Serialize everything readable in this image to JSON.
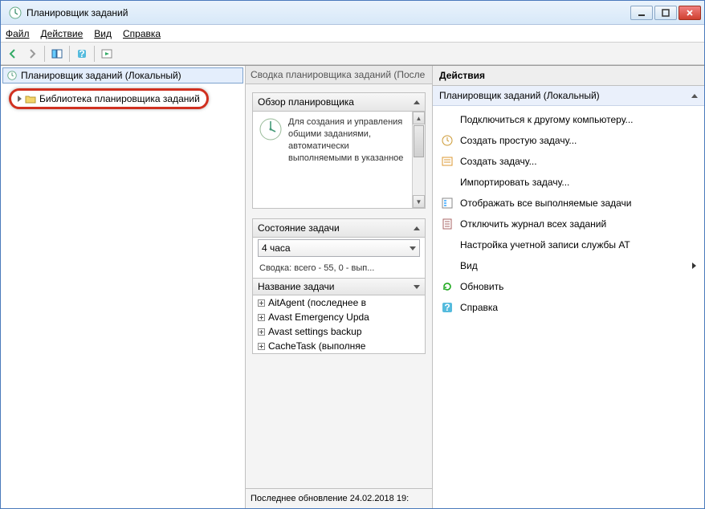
{
  "window": {
    "title": "Планировщик заданий"
  },
  "menubar": {
    "file": "Файл",
    "action": "Действие",
    "view": "Вид",
    "help": "Справка"
  },
  "tree": {
    "root": "Планировщик заданий (Локальный)",
    "library": "Библиотека планировщика заданий"
  },
  "summary": {
    "header": "Сводка планировщика заданий (После",
    "overview_title": "Обзор планировщика",
    "overview_text": "Для создания и управления общими заданиями, автоматически выполняемыми в указанное",
    "task_status_title": "Состояние задачи",
    "period_value": "4 часа",
    "stats_line": "Сводка: всего - 55, 0 - вып...",
    "tasklist_header": "Название задачи",
    "tasks": [
      "AitAgent (последнее в",
      "Avast Emergency Upda",
      "Avast settings backup",
      "CacheTask (выполняе"
    ],
    "footer": "Последнее обновление 24.02.2018 19:"
  },
  "actions": {
    "panel_title": "Действия",
    "section_head": "Планировщик заданий (Локальный)",
    "items": [
      {
        "icon": "connect",
        "label": "Подключиться к другому компьютеру..."
      },
      {
        "icon": "simple-task",
        "label": "Создать простую задачу..."
      },
      {
        "icon": "task",
        "label": "Создать задачу..."
      },
      {
        "icon": "import",
        "label": "Импортировать задачу..."
      },
      {
        "icon": "running",
        "label": "Отображать все выполняемые задачи"
      },
      {
        "icon": "log-off",
        "label": "Отключить журнал всех заданий"
      },
      {
        "icon": "none",
        "label": "Настройка учетной записи службы AT"
      },
      {
        "icon": "none",
        "label": "Вид",
        "submenu": true
      },
      {
        "icon": "refresh",
        "label": "Обновить"
      },
      {
        "icon": "help",
        "label": "Справка"
      }
    ]
  }
}
